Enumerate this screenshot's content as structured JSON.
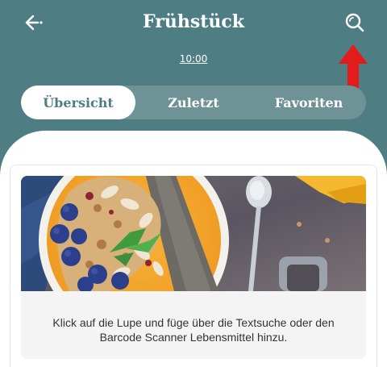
{
  "header": {
    "title": "Frühstück",
    "time": "10:00",
    "back_icon": "arrow-left-icon",
    "search_icon": "search-icon",
    "annotation_icon": "red-arrow-up-icon"
  },
  "tabs": [
    {
      "label": "Übersicht",
      "active": true
    },
    {
      "label": "Zuletzt",
      "active": false
    },
    {
      "label": "Favoriten",
      "active": false
    }
  ],
  "content": {
    "image_icon": "smoothie-bowl-image",
    "hint": "Klick auf die Lupe und füge über die Textsuche oder den Barcode Scanner Lebensmittel hinzu."
  },
  "colors": {
    "primary": "#4f7d84",
    "tab_bar": "#6f9297",
    "annotation": "#e41b1b",
    "hint_background": "#f4f4f4"
  }
}
